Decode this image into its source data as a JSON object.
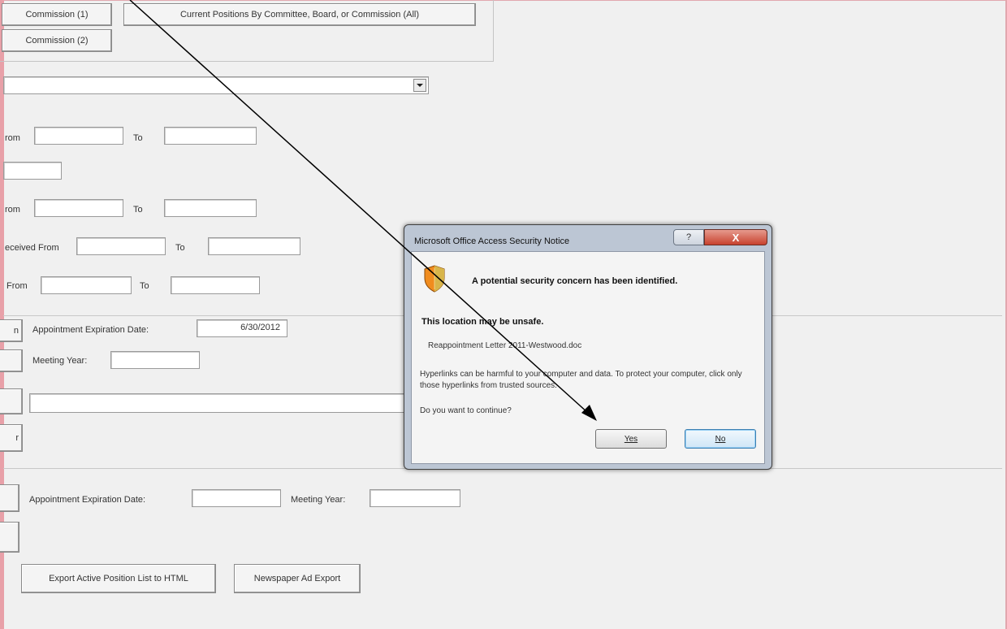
{
  "window": {
    "tab_commission_1": "Commission (1)",
    "tab_current_positions_all": "Current Positions By Committee, Board, or Commission (All)",
    "tab_commission_2": "Commission (2)"
  },
  "form": {
    "from_label_1": "rom",
    "to_label_1": "To",
    "from_label_2": "rom",
    "to_label_2": "To",
    "received_from_label": "eceived From",
    "to_label_3": "To",
    "from_label_4": "From",
    "to_label_4": "To",
    "button_n": "n",
    "appointment_expiration_label": "Appointment Expiration Date:",
    "appointment_expiration_value": "6/30/2012",
    "meeting_year_label": "Meeting Year:",
    "button_r": "r",
    "appointment_expiration_label_2": "Appointment Expiration Date:",
    "meeting_year_label_2": "Meeting Year:",
    "export_html_button": "Export Active Position List to HTML",
    "newspaper_export_button": "Newspaper Ad Export"
  },
  "dialog": {
    "title": "Microsoft Office Access Security Notice",
    "help_glyph": "?",
    "close_glyph": "X",
    "heading": "A potential security concern has been identified.",
    "warning": "This location may be unsafe.",
    "file": "Reappointment Letter 2011-Westwood.doc",
    "paragraph": "Hyperlinks can be harmful to your computer and data. To protect your computer, click only those hyperlinks from trusted sources.",
    "question": "Do you want to continue?",
    "yes_label": "Yes",
    "no_label": "No"
  },
  "icons": {
    "shield": "shield-warning-icon",
    "dropdown": "chevron-down-icon",
    "pointer": "arrow-annotation"
  },
  "colors": {
    "background": "#f0f0f0",
    "dialog_frame": "#bcc6d4",
    "close_button": "#c8422e",
    "shield_orange": "#f08c1e",
    "border_pink": "#e2a7ae"
  }
}
